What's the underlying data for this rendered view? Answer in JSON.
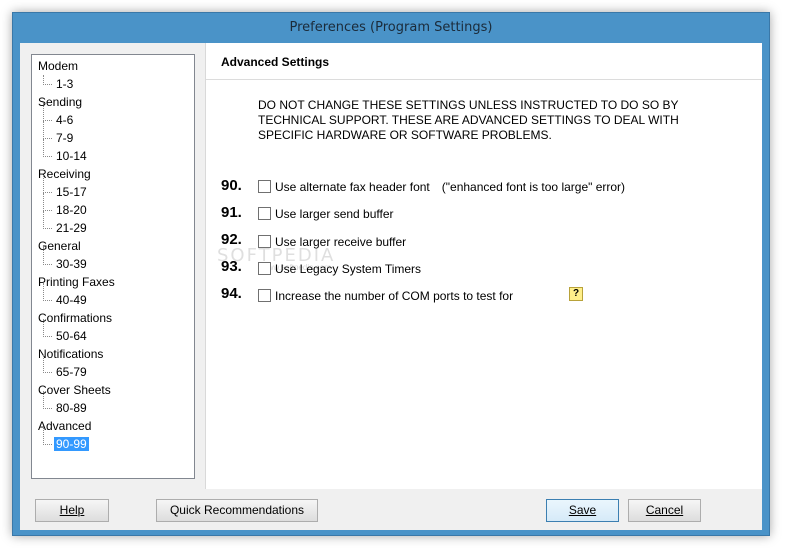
{
  "window": {
    "title": "Preferences (Program Settings)"
  },
  "tree": {
    "categories": [
      {
        "label": "Modem",
        "children": [
          "1-3"
        ]
      },
      {
        "label": "Sending",
        "children": [
          "4-6",
          "7-9",
          "10-14"
        ]
      },
      {
        "label": "Receiving",
        "children": [
          "15-17",
          "18-20",
          "21-29"
        ]
      },
      {
        "label": "General",
        "children": [
          "30-39"
        ]
      },
      {
        "label": "Printing Faxes",
        "children": [
          "40-49"
        ]
      },
      {
        "label": "Confirmations",
        "children": [
          "50-64"
        ]
      },
      {
        "label": "Notifications",
        "children": [
          "65-79"
        ]
      },
      {
        "label": "Cover Sheets",
        "children": [
          "80-89"
        ]
      },
      {
        "label": "Advanced",
        "children": [
          "90-99"
        ]
      }
    ],
    "selected": "90-99"
  },
  "panel": {
    "title": "Advanced Settings",
    "warning": "DO NOT CHANGE THESE SETTINGS UNLESS INSTRUCTED TO DO SO BY TECHNICAL SUPPORT. THESE ARE ADVANCED SETTINGS TO DEAL WITH SPECIFIC HARDWARE OR SOFTWARE PROBLEMS.",
    "settings": [
      {
        "number": "90.",
        "label": "Use alternate fax header font",
        "note": "(\"enhanced font is too large\" error)",
        "checked": false
      },
      {
        "number": "91.",
        "label": "Use larger send buffer",
        "note": "",
        "checked": false
      },
      {
        "number": "92.",
        "label": "Use larger receive buffer",
        "note": "",
        "checked": false
      },
      {
        "number": "93.",
        "label": "Use Legacy System Timers",
        "note": "",
        "checked": false
      },
      {
        "number": "94.",
        "label": "Increase the number of COM ports to test for",
        "note": "",
        "checked": false
      }
    ],
    "help_icon": "question-mark-icon",
    "watermark": "SOFTPEDIA",
    "watermark_url": "www.softpedia.com"
  },
  "buttons": {
    "help": "Help",
    "quick_recommendations": "Quick Recommendations",
    "save": "Save",
    "cancel": "Cancel"
  },
  "colors": {
    "window_frame": "#4a93c8",
    "selection": "#3399ff"
  }
}
